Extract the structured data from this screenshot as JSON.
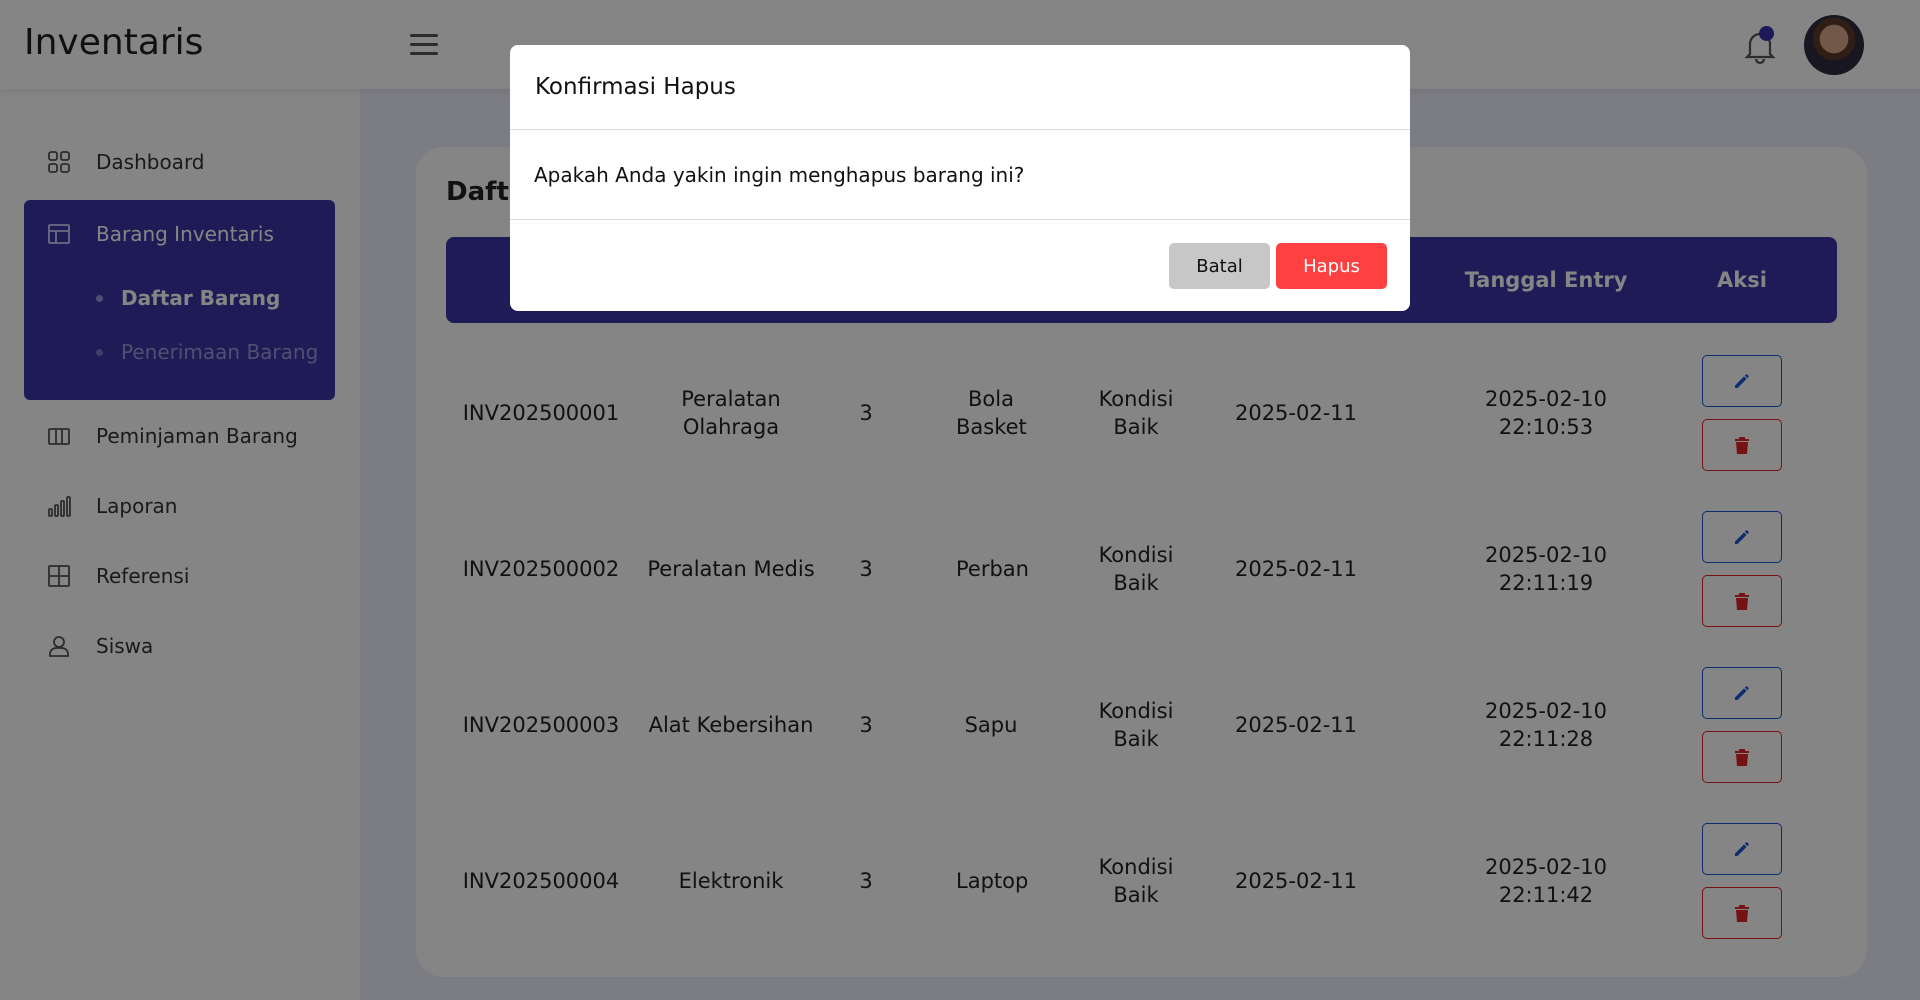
{
  "header": {
    "brand": "Inventaris",
    "menu_icon": "hamburger-icon",
    "notification_icon": "bell-icon",
    "avatar_icon": "user-avatar"
  },
  "sidebar": {
    "items": [
      {
        "label": "Dashboard",
        "icon": "grid-icon"
      },
      {
        "label": "Barang Inventaris",
        "icon": "layout-icon"
      },
      {
        "label": "Peminjaman Barang",
        "icon": "columns-icon"
      },
      {
        "label": "Laporan",
        "icon": "bar-chart-icon"
      },
      {
        "label": "Referensi",
        "icon": "table-icon"
      },
      {
        "label": "Siswa",
        "icon": "user-icon"
      }
    ],
    "subitems": [
      {
        "label": "Daftar Barang",
        "active": true
      },
      {
        "label": "Penerimaan Barang",
        "active": false
      }
    ]
  },
  "main": {
    "title": "Daftar Barang",
    "columns": [
      "",
      "",
      "",
      "",
      "",
      "",
      "Tanggal Entry",
      "Aksi"
    ],
    "rows": [
      {
        "kode": "INV202500001",
        "kategori": "Peralatan Olahraga",
        "jumlah": "3",
        "nama": "Bola Basket",
        "kondisi": "Kondisi Baik",
        "tanggal": "2025-02-11",
        "entry": "2025-02-10 22:10:53"
      },
      {
        "kode": "INV202500002",
        "kategori": "Peralatan Medis",
        "jumlah": "3",
        "nama": "Perban",
        "kondisi": "Kondisi Baik",
        "tanggal": "2025-02-11",
        "entry": "2025-02-10 22:11:19"
      },
      {
        "kode": "INV202500003",
        "kategori": "Alat Kebersihan",
        "jumlah": "3",
        "nama": "Sapu",
        "kondisi": "Kondisi Baik",
        "tanggal": "2025-02-11",
        "entry": "2025-02-10 22:11:28"
      },
      {
        "kode": "INV202500004",
        "kategori": "Elektronik",
        "jumlah": "3",
        "nama": "Laptop",
        "kondisi": "Kondisi Baik",
        "tanggal": "2025-02-11",
        "entry": "2025-02-10 22:11:42"
      }
    ],
    "edit_icon": "pencil-icon",
    "delete_icon": "trash-icon"
  },
  "modal": {
    "title": "Konfirmasi Hapus",
    "message": "Apakah Anda yakin ingin menghapus barang ini?",
    "cancel_label": "Batal",
    "confirm_label": "Hapus"
  },
  "colors": {
    "primary": "#3b35a6",
    "danger": "#ff4040",
    "edit": "#1a56d6",
    "neutral_button": "#c7c7c7"
  }
}
